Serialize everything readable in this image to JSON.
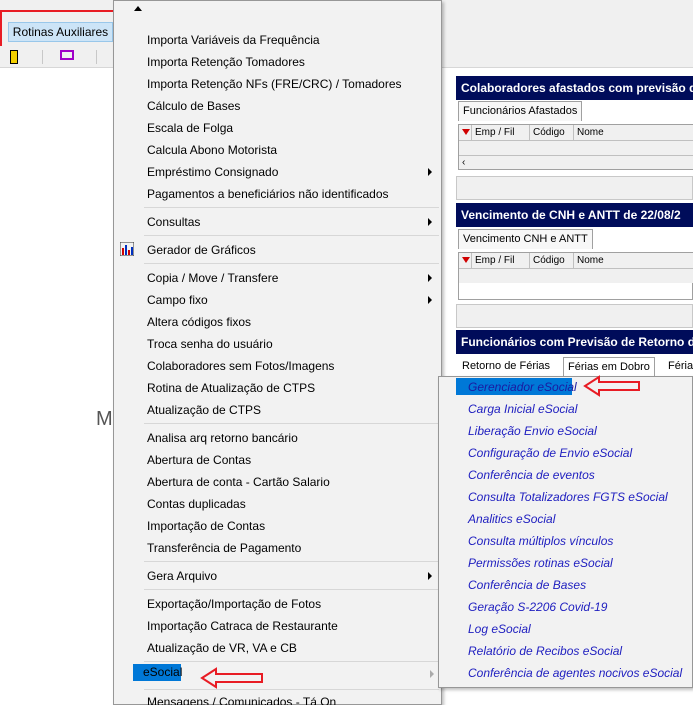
{
  "toolbar": {
    "rotinas_label": "Rotinas Auxiliares"
  },
  "background": {
    "letter": "M"
  },
  "panels": {
    "afastados": {
      "title": "Colaboradores afastados com previsão de",
      "tab": "Funcionários Afastados",
      "cols": [
        "Emp / Fil",
        "Código",
        "Nome"
      ]
    },
    "cnh": {
      "title": "Vencimento de CNH e ANTT de 22/08/2",
      "tab": "Vencimento CNH e ANTT",
      "cols": [
        "Emp / Fil",
        "Código",
        "Nome"
      ]
    },
    "retorno": {
      "title": "Funcionários com Previsão de Retorno de",
      "tabs": [
        "Retorno de Férias",
        "Férias em Dobro",
        "Féria"
      ]
    }
  },
  "menu": {
    "items": [
      "Importa Variáveis da Frequência",
      "Importa Retenção Tomadores",
      "Importa Retenção NFs (FRE/CRC) / Tomadores",
      "Cálculo de Bases",
      "Escala de Folga",
      "Calcula Abono Motorista",
      "Empréstimo Consignado",
      "Pagamentos a beneficiários não identificados",
      "Consultas",
      "Gerador de Gráficos",
      "Copia / Move / Transfere",
      "Campo fixo",
      "Altera códigos fixos",
      "Troca senha do usuário",
      "Colaboradores sem Fotos/Imagens",
      "Rotina de Atualização de CTPS",
      "Atualização de CTPS",
      "Analisa arq retorno bancário",
      "Abertura de Contas",
      "Abertura de conta - Cartão Salario",
      "Contas duplicadas",
      "Importação de Contas",
      "Transferência de Pagamento",
      "Gera Arquivo",
      "Exportação/Importação de Fotos",
      "Importação Catraca de Restaurante",
      "Atualização de VR, VA e CB",
      "eSocial",
      "Mensagens / Comunicados - Tá On"
    ]
  },
  "submenu": {
    "items": [
      "Gerenciador eSocial",
      "Carga Inicial eSocial",
      "Liberação Envio eSocial",
      "Configuração de Envio eSocial",
      "Conferência de eventos",
      "Consulta Totalizadores FGTS eSocial",
      "Analitics eSocial",
      "Consulta múltiplos vínculos",
      "Permissões rotinas eSocial",
      "Conferência de Bases",
      "Geração S-2206 Covid-19",
      "Log eSocial",
      "Relatório de Recibos eSocial",
      "Conferência de agentes nocivos eSocial"
    ]
  },
  "colors": {
    "highlight": "#0078d7",
    "annotation": "#e81c24",
    "panel_title_bg": "#000c5a",
    "submenu_text": "#2020c0"
  }
}
